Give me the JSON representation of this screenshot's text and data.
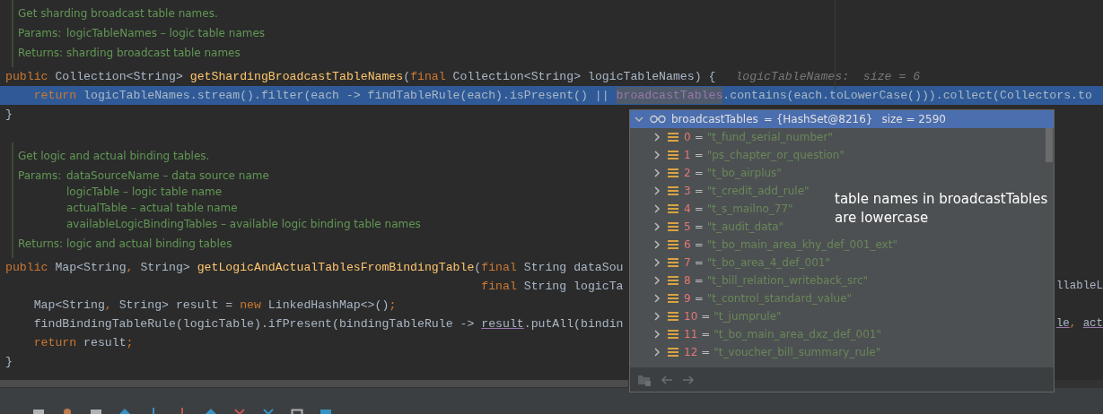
{
  "editor": {
    "blocks": [
      {
        "kind": "doc",
        "summary": "Get sharding broadcast table names.",
        "sections": [
          {
            "label": "Params:",
            "items": [
              "logicTableNames – logic table names"
            ]
          },
          {
            "label": "Returns:",
            "items": [
              "sharding broadcast table names"
            ]
          }
        ]
      },
      {
        "kind": "code",
        "selected": false,
        "tokens": [
          {
            "text": "public ",
            "kind": "keyword"
          },
          {
            "text": "Collection<String> ",
            "kind": "plain"
          },
          {
            "text": "getShardingBroadcastTableNames",
            "kind": "method"
          },
          {
            "text": "(",
            "kind": "plain"
          },
          {
            "text": "final ",
            "kind": "keyword"
          },
          {
            "text": "Collection<String> logicTableNames) {",
            "kind": "plain"
          }
        ],
        "hint": "logicTableNames:  size = 6"
      },
      {
        "kind": "code",
        "selected": true,
        "tokens": [
          {
            "text": "    return ",
            "kind": "keyword"
          },
          {
            "text": "logicTableNames.stream().filter(each -> findTableRule(each).isPresent() || ",
            "kind": "plain"
          },
          {
            "text": "broadcastTables",
            "kind": "hover"
          },
          {
            "text": ".contains(each.toLowerCase())).collect(Collectors.to",
            "kind": "plain"
          }
        ]
      },
      {
        "kind": "code",
        "selected": false,
        "tokens": [
          {
            "text": "}",
            "kind": "plain"
          }
        ]
      },
      {
        "kind": "blank"
      },
      {
        "kind": "doc",
        "summary": "Get logic and actual binding tables.",
        "sections": [
          {
            "label": "Params:",
            "items": [
              "dataSourceName – data source name",
              "logicTable – logic table name",
              "actualTable – actual table name",
              "availableLogicBindingTables – available logic binding table names"
            ]
          },
          {
            "label": "Returns:",
            "items": [
              "logic and actual binding tables"
            ]
          }
        ]
      },
      {
        "kind": "code",
        "selected": false,
        "tokens": [
          {
            "text": "public ",
            "kind": "keyword"
          },
          {
            "text": "Map<String",
            "kind": "plain"
          },
          {
            "text": ", ",
            "kind": "keyword"
          },
          {
            "text": "String> ",
            "kind": "plain"
          },
          {
            "text": "getLogicAndActualTablesFromBindingTable",
            "kind": "method"
          },
          {
            "text": "(",
            "kind": "plain"
          },
          {
            "text": "final ",
            "kind": "keyword"
          },
          {
            "text": "String dataSou",
            "kind": "plain"
          }
        ]
      },
      {
        "kind": "code",
        "selected": false,
        "tokens": [
          {
            "text": "                                                                   final ",
            "kind": "keyword"
          },
          {
            "text": "String logicTa",
            "kind": "plain"
          }
        ],
        "right": [
          {
            "text": "llableL",
            "kind": "plain"
          }
        ]
      },
      {
        "kind": "code",
        "selected": false,
        "tokens": [
          {
            "text": "    Map<String",
            "kind": "plain"
          },
          {
            "text": ", ",
            "kind": "keyword"
          },
          {
            "text": "String> result = ",
            "kind": "plain"
          },
          {
            "text": "new ",
            "kind": "keyword"
          },
          {
            "text": "LinkedHashMap<>()",
            "kind": "plain"
          },
          {
            "text": ";",
            "kind": "keyword"
          }
        ]
      },
      {
        "kind": "code",
        "selected": false,
        "tokens": [
          {
            "text": "    findBindingTableRule(logicTable).ifPresent(bindingTableRule -> ",
            "kind": "plain"
          },
          {
            "text": "result",
            "kind": "ref"
          },
          {
            "text": ".putAll(bindin",
            "kind": "plain"
          }
        ],
        "right": [
          {
            "text": "le",
            "kind": "ref"
          },
          {
            "text": ", ",
            "kind": "keyword"
          },
          {
            "text": "act",
            "kind": "ref"
          }
        ]
      },
      {
        "kind": "code",
        "selected": false,
        "tokens": [
          {
            "text": "    return ",
            "kind": "keyword"
          },
          {
            "text": "result",
            "kind": "plain"
          },
          {
            "text": ";",
            "kind": "keyword"
          }
        ]
      },
      {
        "kind": "code",
        "selected": false,
        "tokens": [
          {
            "text": "}",
            "kind": "plain"
          }
        ]
      }
    ]
  },
  "popup": {
    "header": {
      "name": "broadcastTables",
      "value": "= {HashSet@8216}",
      "size": "size = 2590",
      "expanded": true,
      "selected": true
    },
    "items": [
      {
        "index": "0",
        "operator": "=",
        "value": "\"t_fund_serial_number\"",
        "expanded": false
      },
      {
        "index": "1",
        "operator": "=",
        "value": "\"ps_chapter_or_question\"",
        "expanded": false
      },
      {
        "index": "2",
        "operator": "=",
        "value": "\"t_bo_airplus\"",
        "expanded": false
      },
      {
        "index": "3",
        "operator": "=",
        "value": "\"t_credit_add_rule\"",
        "expanded": false
      },
      {
        "index": "4",
        "operator": "=",
        "value": "\"t_s_mailno_77\"",
        "expanded": false
      },
      {
        "index": "5",
        "operator": "=",
        "value": "\"t_audit_data\"",
        "expanded": false
      },
      {
        "index": "6",
        "operator": "=",
        "value": "\"t_bo_main_area_khy_def_001_ext\"",
        "expanded": false
      },
      {
        "index": "7",
        "operator": "=",
        "value": "\"t_bo_area_4_def_001\"",
        "expanded": false
      },
      {
        "index": "8",
        "operator": "=",
        "value": "\"t_bill_relation_writeback_src\"",
        "expanded": false
      },
      {
        "index": "9",
        "operator": "=",
        "value": "\"t_control_standard_value\"",
        "expanded": false
      },
      {
        "index": "10",
        "operator": "=",
        "value": "\"t_jumprule\"",
        "expanded": false
      },
      {
        "index": "11",
        "operator": "=",
        "value": "\"t_bo_main_area_dxz_def_001\"",
        "expanded": false
      },
      {
        "index": "12",
        "operator": "=",
        "value": "\"t_voucher_bill_summary_rule\"",
        "expanded": false
      }
    ],
    "annotation": [
      "table names in broadcastTables",
      "are lowercase"
    ]
  }
}
